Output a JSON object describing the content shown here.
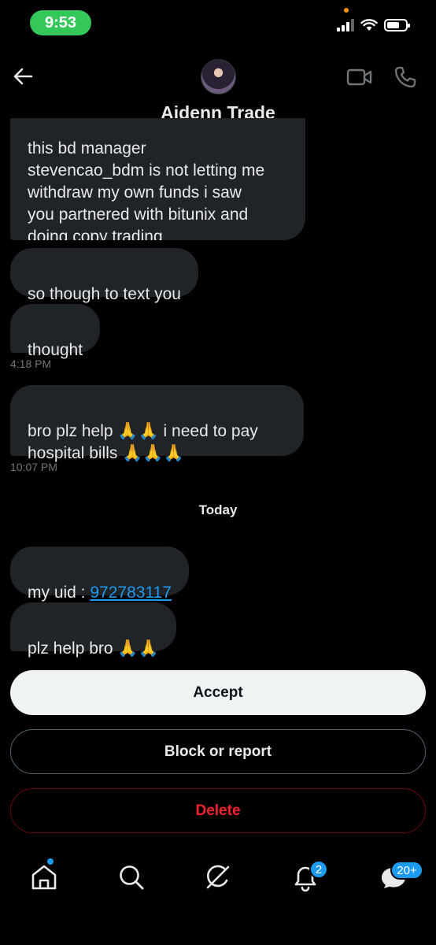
{
  "status_bar": {
    "time": "9:53",
    "signal_bars_filled": 3,
    "battery_level": 0.7
  },
  "header": {
    "title": "Aidenn Trade"
  },
  "messages": [
    {
      "text_cut": "this bd manager",
      "text": "stevencao_bdm is not letting me\nwithdraw my own funds i saw\nyou partnered with bitunix and\ndoing copy trading"
    },
    {
      "text": "so though to text you"
    },
    {
      "text": "thought",
      "time": "4:18 PM"
    },
    {
      "text": "bro plz help 🙏🙏 i need to pay\nhospital bills 🙏🙏🙏",
      "time": "10:07 PM"
    },
    {
      "text_prefix": "my uid : ",
      "link": "972783117"
    },
    {
      "text": "plz help bro 🙏🙏"
    }
  ],
  "day_separator": "Today",
  "actions": {
    "accept": "Accept",
    "block": "Block or report",
    "delete": "Delete"
  },
  "nav": {
    "notifications_badge": "2",
    "messages_badge": "20+"
  },
  "colors": {
    "accent": "#1d9bf0",
    "danger": "#f4212e",
    "bubble": "#202327",
    "status_pill": "#34c759"
  }
}
